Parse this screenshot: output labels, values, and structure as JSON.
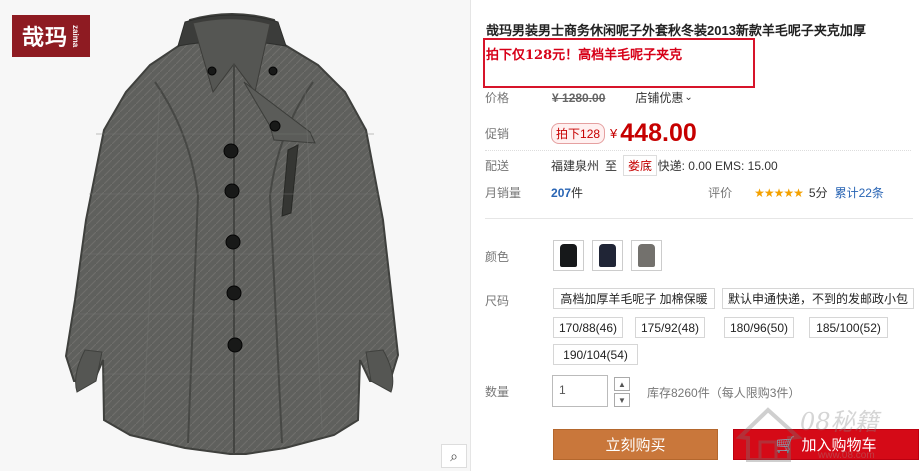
{
  "brand_logo": {
    "text": "哉玛",
    "subtext": "zaima"
  },
  "product": {
    "title": "哉玛男装男士商务休闲呢子外套秋冬装2013新款羊毛呢子夹克加厚",
    "promo": "拍下仅128元！高档羊毛呢子夹克",
    "price_label": "价格",
    "original_price": "¥ 1280.00",
    "shop_discount": "店铺优惠",
    "sale_label": "促销",
    "sale_badge": "拍下128",
    "sale_currency": "¥",
    "sale_price": "448.00",
    "delivery_label": "配送",
    "origin": "福建泉州",
    "to": "至",
    "destination": "娄底",
    "shipping": "快递: 0.00 EMS: 15.00",
    "sales_label": "月销量",
    "sales_count": "207",
    "sales_unit": "件",
    "rating_label": "评价",
    "stars": "★★★★★",
    "score": "5分",
    "reviews": "累计22条"
  },
  "options": {
    "color_label": "颜色",
    "colors": [
      {
        "name": "black-coat",
        "color": "#16181a"
      },
      {
        "name": "navy-coat",
        "color": "#202536"
      },
      {
        "name": "gray-coat",
        "color": "#73716d"
      }
    ],
    "size_label": "尺码",
    "sizes": [
      "高档加厚羊毛呢子 加棉保暖",
      "默认申通快递，不到的发邮政小包",
      "170/88(46)",
      "175/92(48)",
      "180/96(50)",
      "185/100(52)",
      "190/104(54)"
    ],
    "quantity_label": "数量",
    "quantity": "1",
    "stock": "库存8260件（每人限购3件）"
  },
  "buttons": {
    "buy": "立刻购买",
    "cart": "加入购物车"
  },
  "watermark": {
    "text": "08秘籍",
    "url": "www.08.com"
  },
  "colors": {
    "brand_red": "#8e1b22",
    "price_red": "#c60000",
    "cart_red": "#d50a17",
    "buy_orange": "#c9773b",
    "link_blue": "#2864b4",
    "star_yellow": "#f4a100"
  },
  "icons": [
    "magnifier-icon",
    "cart-icon",
    "chevron-down-icon",
    "up-arrow-icon",
    "down-arrow-icon",
    "star-icon"
  ]
}
